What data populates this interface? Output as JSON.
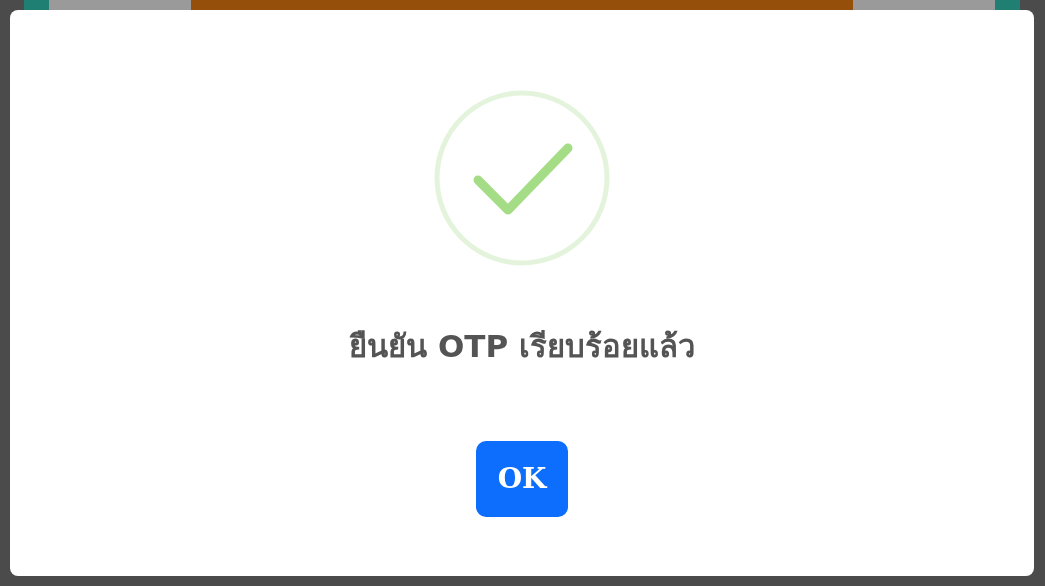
{
  "dialog": {
    "title": "ยืนยัน OTP เรียบร้อยแล้ว",
    "buttons": [
      {
        "label": "OK"
      }
    ]
  }
}
